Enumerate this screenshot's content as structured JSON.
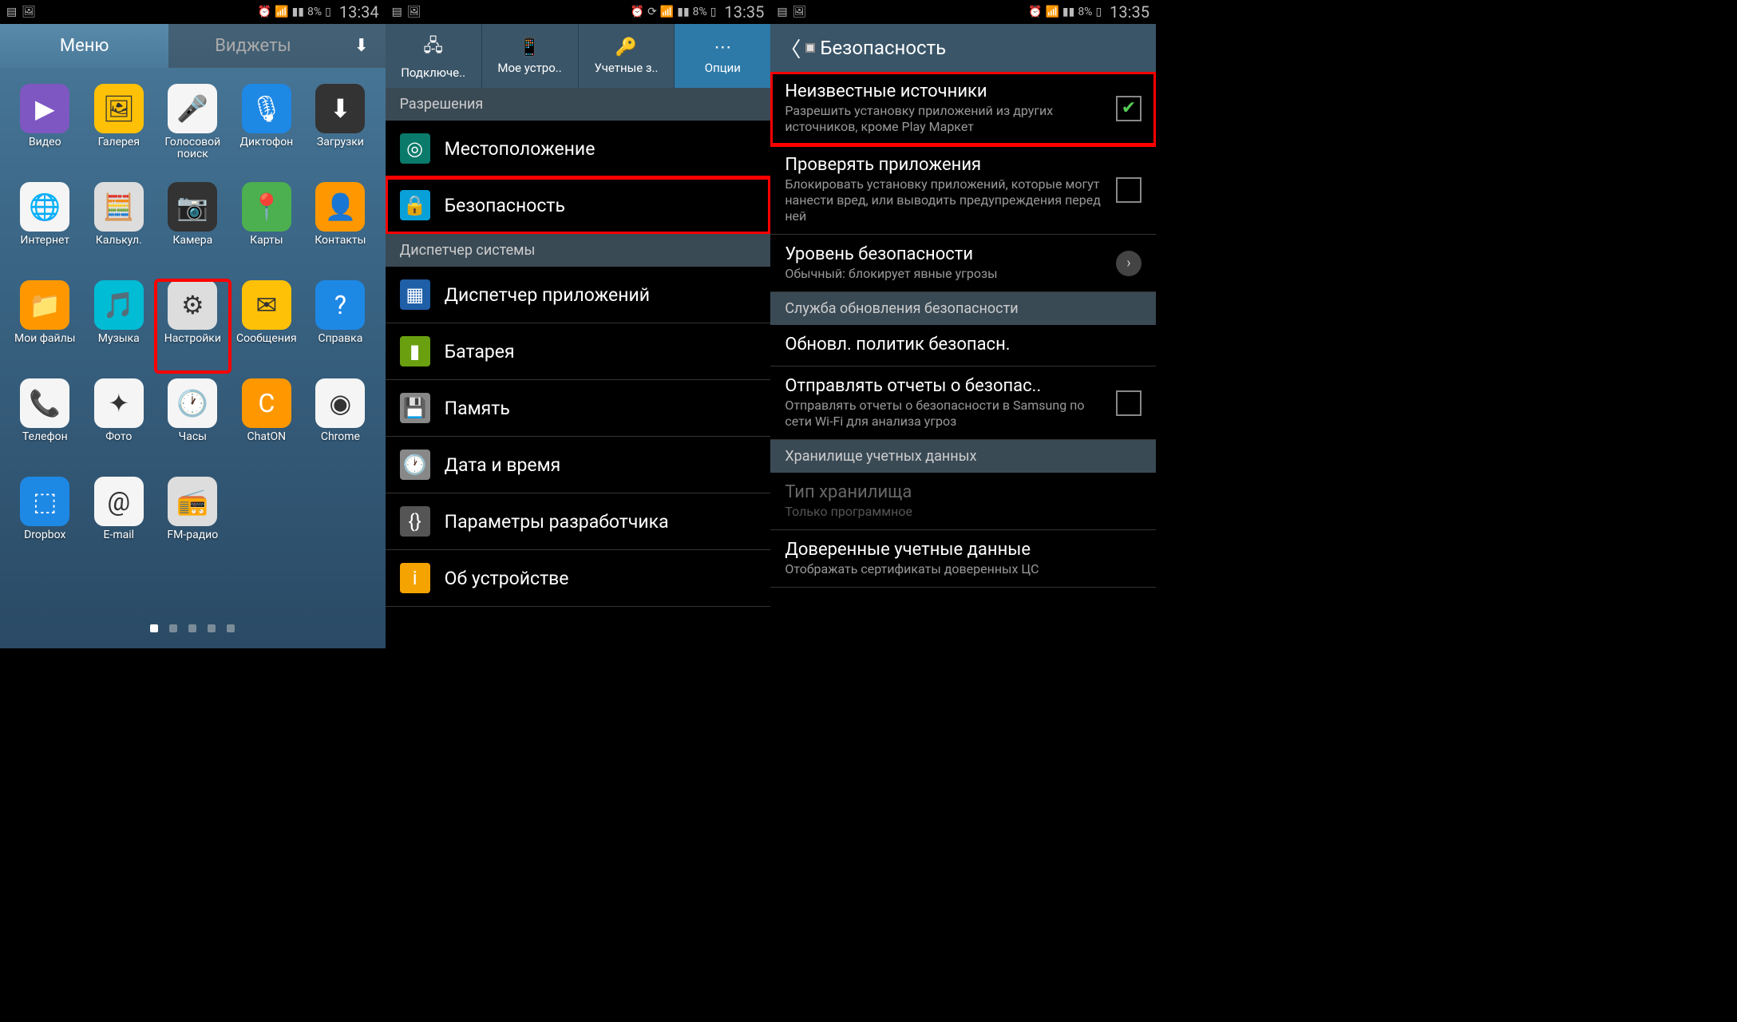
{
  "status": {
    "battery": "8%",
    "time1": "13:34",
    "time2": "13:35",
    "time3": "13:35"
  },
  "phone1": {
    "tabs": {
      "menu": "Меню",
      "widgets": "Виджеты"
    },
    "apps": [
      {
        "label": "Видео",
        "glyph": "▶",
        "cls": "bg-purple"
      },
      {
        "label": "Галерея",
        "glyph": "🖼",
        "cls": "bg-yellow"
      },
      {
        "label": "Голосовой поиск",
        "glyph": "🎤",
        "cls": "bg-white"
      },
      {
        "label": "Диктофон",
        "glyph": "🎙",
        "cls": "bg-blue"
      },
      {
        "label": "Загрузки",
        "glyph": "⬇",
        "cls": "bg-dark"
      },
      {
        "label": "Интернет",
        "glyph": "🌐",
        "cls": "bg-white"
      },
      {
        "label": "Калькул.",
        "glyph": "🧮",
        "cls": "bg-grey"
      },
      {
        "label": "Камера",
        "glyph": "📷",
        "cls": "bg-dark"
      },
      {
        "label": "Карты",
        "glyph": "📍",
        "cls": "bg-green"
      },
      {
        "label": "Контакты",
        "glyph": "👤",
        "cls": "bg-orange"
      },
      {
        "label": "Мои файлы",
        "glyph": "📁",
        "cls": "bg-orange"
      },
      {
        "label": "Музыка",
        "glyph": "🎵",
        "cls": "bg-cyan"
      },
      {
        "label": "Настройки",
        "glyph": "⚙",
        "cls": "bg-grey",
        "highlight": true
      },
      {
        "label": "Сообщения",
        "glyph": "✉",
        "cls": "bg-yellow"
      },
      {
        "label": "Справка",
        "glyph": "?",
        "cls": "bg-blue"
      },
      {
        "label": "Телефон",
        "glyph": "📞",
        "cls": "bg-white"
      },
      {
        "label": "Фото",
        "glyph": "✦",
        "cls": "bg-white"
      },
      {
        "label": "Часы",
        "glyph": "🕐",
        "cls": "bg-white"
      },
      {
        "label": "ChatON",
        "glyph": "C",
        "cls": "bg-orange"
      },
      {
        "label": "Chrome",
        "glyph": "◉",
        "cls": "bg-white"
      },
      {
        "label": "Dropbox",
        "glyph": "⬚",
        "cls": "bg-blue"
      },
      {
        "label": "E-mail",
        "glyph": "@",
        "cls": "bg-white"
      },
      {
        "label": "FM-радио",
        "glyph": "📻",
        "cls": "bg-grey"
      }
    ]
  },
  "phone2": {
    "tabs": [
      {
        "label": "Подключе..",
        "icon": "🖧"
      },
      {
        "label": "Мое устро..",
        "icon": "📱"
      },
      {
        "label": "Учетные з..",
        "icon": "🔑"
      },
      {
        "label": "Опции",
        "icon": "⋯",
        "active": true
      }
    ],
    "sections": [
      {
        "header": "Разрешения",
        "items": [
          {
            "label": "Местоположение",
            "icon": "◎",
            "cls": "teal"
          },
          {
            "label": "Безопасность",
            "icon": "🔒",
            "cls": "cyan",
            "highlight": true
          }
        ]
      },
      {
        "header": "Диспетчер системы",
        "items": [
          {
            "label": "Диспетчер приложений",
            "icon": "▦",
            "cls": "blue"
          },
          {
            "label": "Батарея",
            "icon": "▮",
            "cls": "green"
          },
          {
            "label": "Память",
            "icon": "💾",
            "cls": "grey"
          },
          {
            "label": "Дата и время",
            "icon": "🕐",
            "cls": "grey"
          },
          {
            "label": "Параметры разработчика",
            "icon": "{}",
            "cls": "dgrey"
          },
          {
            "label": "Об устройстве",
            "icon": "i",
            "cls": "yellow"
          }
        ]
      }
    ]
  },
  "phone3": {
    "header": "Безопасность",
    "items": [
      {
        "title": "Неизвестные источники",
        "sub": "Разрешить установку приложений из других источников, кроме Play Маркет",
        "ctrl": "check",
        "checked": true,
        "highlight": true
      },
      {
        "title": "Проверять приложения",
        "sub": "Блокировать установку приложений, которые могут нанести вред, или выводить предупреждения перед ней",
        "ctrl": "check",
        "checked": false
      },
      {
        "title": "Уровень безопасности",
        "sub": "Обычный: блокирует явные угрозы",
        "ctrl": "chevron"
      },
      {
        "header": "Служба обновления безопасности"
      },
      {
        "title": "Обновл. политик безопасн."
      },
      {
        "title": "Отправлять отчеты о безопас..",
        "sub": "Отправлять отчеты о безопасности в Samsung по сети Wi-Fi для анализа угроз",
        "ctrl": "check",
        "checked": false
      },
      {
        "header": "Хранилище учетных данных"
      },
      {
        "title": "Тип хранилища",
        "sub": "Только программное",
        "disabled": true
      },
      {
        "title": "Доверенные учетные данные",
        "sub": "Отображать сертификаты доверенных ЦС"
      }
    ]
  }
}
